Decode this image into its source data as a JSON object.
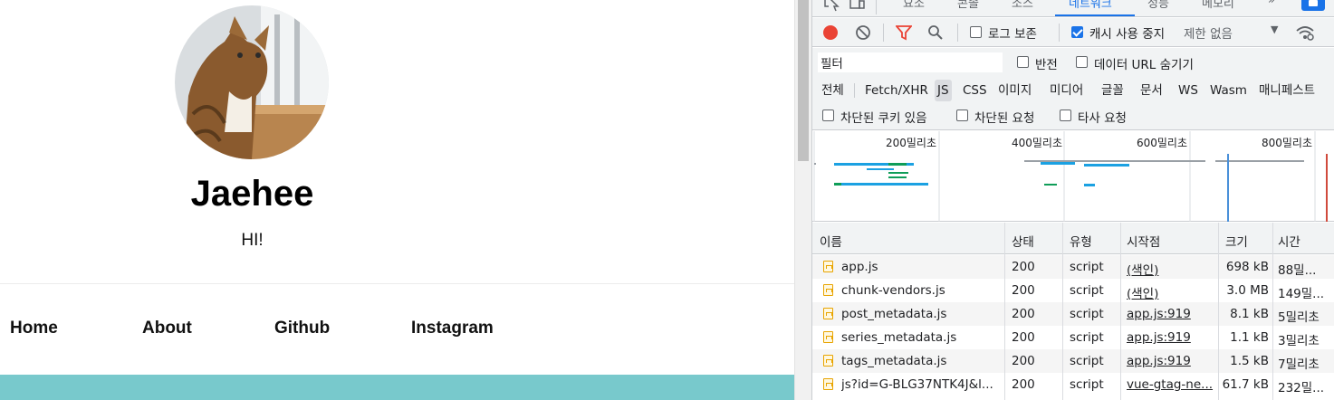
{
  "colors": {
    "accent": "#1a73e8",
    "record": "#ea4335",
    "filter_icon": "#ea4335",
    "teal_bar": "#78c9cc",
    "waterfall_blue": "#1ba1e2",
    "waterfall_green": "#0f9d58",
    "waterfall_gray": "#9aa0a6"
  },
  "profile": {
    "name": "Jaehee",
    "greeting": "HI!"
  },
  "nav": {
    "links": [
      "Home",
      "About",
      "Github",
      "Instagram"
    ]
  },
  "devtools": {
    "tabs": [
      "요소",
      "콘솔",
      "소스",
      "네트워크",
      "성능",
      "메모리",
      "»"
    ],
    "active_tab": "네트워크",
    "toolbar": {
      "preserve_log_label": "로그 보존",
      "preserve_log_checked": false,
      "disable_cache_label": "캐시 사용 중지",
      "disable_cache_checked": true,
      "throttling_label": "제한 없음"
    },
    "filter": {
      "value": "필터",
      "invert_label": "반전",
      "hide_data_urls_label": "데이터 URL 숨기기",
      "types": [
        "전체",
        "Fetch/XHR",
        "JS",
        "CSS",
        "이미지",
        "미디어",
        "글꼴",
        "문서",
        "WS",
        "Wasm",
        "매니페스트"
      ],
      "active_type": "JS",
      "blocked_cookies_label": "차단된 쿠키 있음",
      "blocked_requests_label": "차단된 요청",
      "third_party_label": "타사 요청"
    },
    "overview": {
      "tick_labels": [
        "200밀리초",
        "400밀리초",
        "600밀리초",
        "800밀리초"
      ]
    },
    "table": {
      "headers": [
        "이름",
        "상태",
        "유형",
        "시작점",
        "크기",
        "시간"
      ],
      "rows": [
        {
          "name": "app.js",
          "status": "200",
          "type": "script",
          "initiator": "(색인)",
          "size": "698 kB",
          "time": "88밀..."
        },
        {
          "name": "chunk-vendors.js",
          "status": "200",
          "type": "script",
          "initiator": "(색인)",
          "size": "3.0 MB",
          "time": "149밀..."
        },
        {
          "name": "post_metadata.js",
          "status": "200",
          "type": "script",
          "initiator": "app.js:919",
          "size": "8.1 kB",
          "time": "5밀리초"
        },
        {
          "name": "series_metadata.js",
          "status": "200",
          "type": "script",
          "initiator": "app.js:919",
          "size": "1.1 kB",
          "time": "3밀리초"
        },
        {
          "name": "tags_metadata.js",
          "status": "200",
          "type": "script",
          "initiator": "app.js:919",
          "size": "1.5 kB",
          "time": "7밀리초"
        },
        {
          "name": "js?id=G-BLG37NTK4J&l...",
          "status": "200",
          "type": "script",
          "initiator": "vue-gtag-ne...",
          "size": "61.7 kB",
          "time": "232밀..."
        }
      ]
    }
  }
}
